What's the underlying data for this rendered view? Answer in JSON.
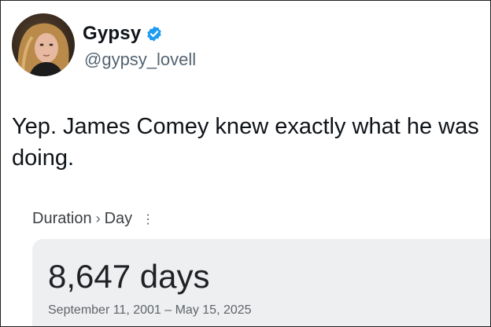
{
  "post": {
    "author": {
      "display_name": "Gypsy",
      "handle": "@gypsy_lovell",
      "verified": true
    },
    "text": "Yep.  James Comey knew exactly what he was doing."
  },
  "embedded_result": {
    "breadcrumb": {
      "root": "Duration",
      "separator": "›",
      "current": "Day",
      "menu_glyph": "⋮"
    },
    "value": "8,647 days",
    "range": "September 11, 2001 – May 15, 2025"
  },
  "colors": {
    "verified_badge": "#1d9bf0",
    "handle": "#536471",
    "card_background": "#eeeff1"
  },
  "icons": [
    "verified-badge-icon",
    "more-vertical-icon"
  ]
}
